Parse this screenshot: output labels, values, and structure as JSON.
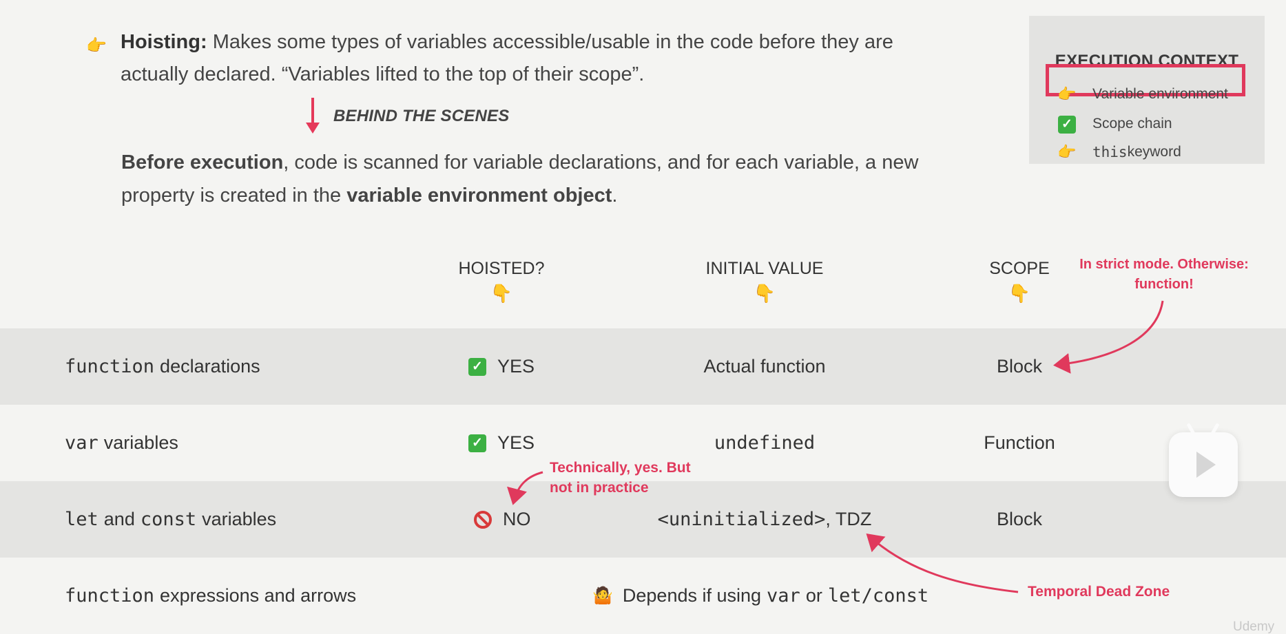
{
  "intro": {
    "lead": "Hoisting:",
    "text": " Makes some types of variables accessible/usable in the code before they are actually declared. “Variables lifted to the top of their scope”.",
    "pointer_icon": "pointing-right-hand-icon"
  },
  "behind": {
    "label": "BEHIND THE SCENES"
  },
  "before": {
    "part1": "Before execution",
    "part2": ", code is scanned for variable declarations, and for each variable, a new property is created in the ",
    "part3": "variable environment object",
    "part4": "."
  },
  "execution_context": {
    "title": "EXECUTION CONTEXT",
    "items": [
      {
        "label": "Variable environment",
        "icon": "pointing-right-hand-icon"
      },
      {
        "label": "Scope chain",
        "icon": "check-mark-icon"
      },
      {
        "code": "this",
        "label": " keyword",
        "icon": "pointing-right-hand-icon"
      }
    ]
  },
  "headers": {
    "hoisted": "HOISTED?",
    "initial": "INITIAL VALUE",
    "scope": "SCOPE"
  },
  "notes": {
    "strict": "In strict mode. Otherwise: function!",
    "technically": "Technically, yes. But not in practice",
    "tdz": "Temporal Dead Zone"
  },
  "rows": [
    {
      "code": "function",
      "name": "declarations",
      "hoisted": "YES",
      "initial": "Actual function",
      "scope": "Block"
    },
    {
      "code": "var",
      "name": "variables",
      "hoisted": "YES",
      "initial_code": "undefined",
      "scope": "Function"
    },
    {
      "code1": "let",
      "and": "and",
      "code2": "const",
      "name": "variables",
      "hoisted": "NO",
      "initial_code": "<uninitialized>",
      "initial_tail": ", TDZ",
      "scope": "Block"
    },
    {
      "code": "function",
      "name": "expressions and arrows",
      "dep_text1": "Depends if using",
      "dep_code1": "var",
      "dep_or": "or",
      "dep_code2": "let/const"
    }
  ],
  "watermark": "Udemy",
  "colors": {
    "accent": "#e0395c",
    "shade": "#e4e4e2",
    "background": "#f4f4f2"
  }
}
